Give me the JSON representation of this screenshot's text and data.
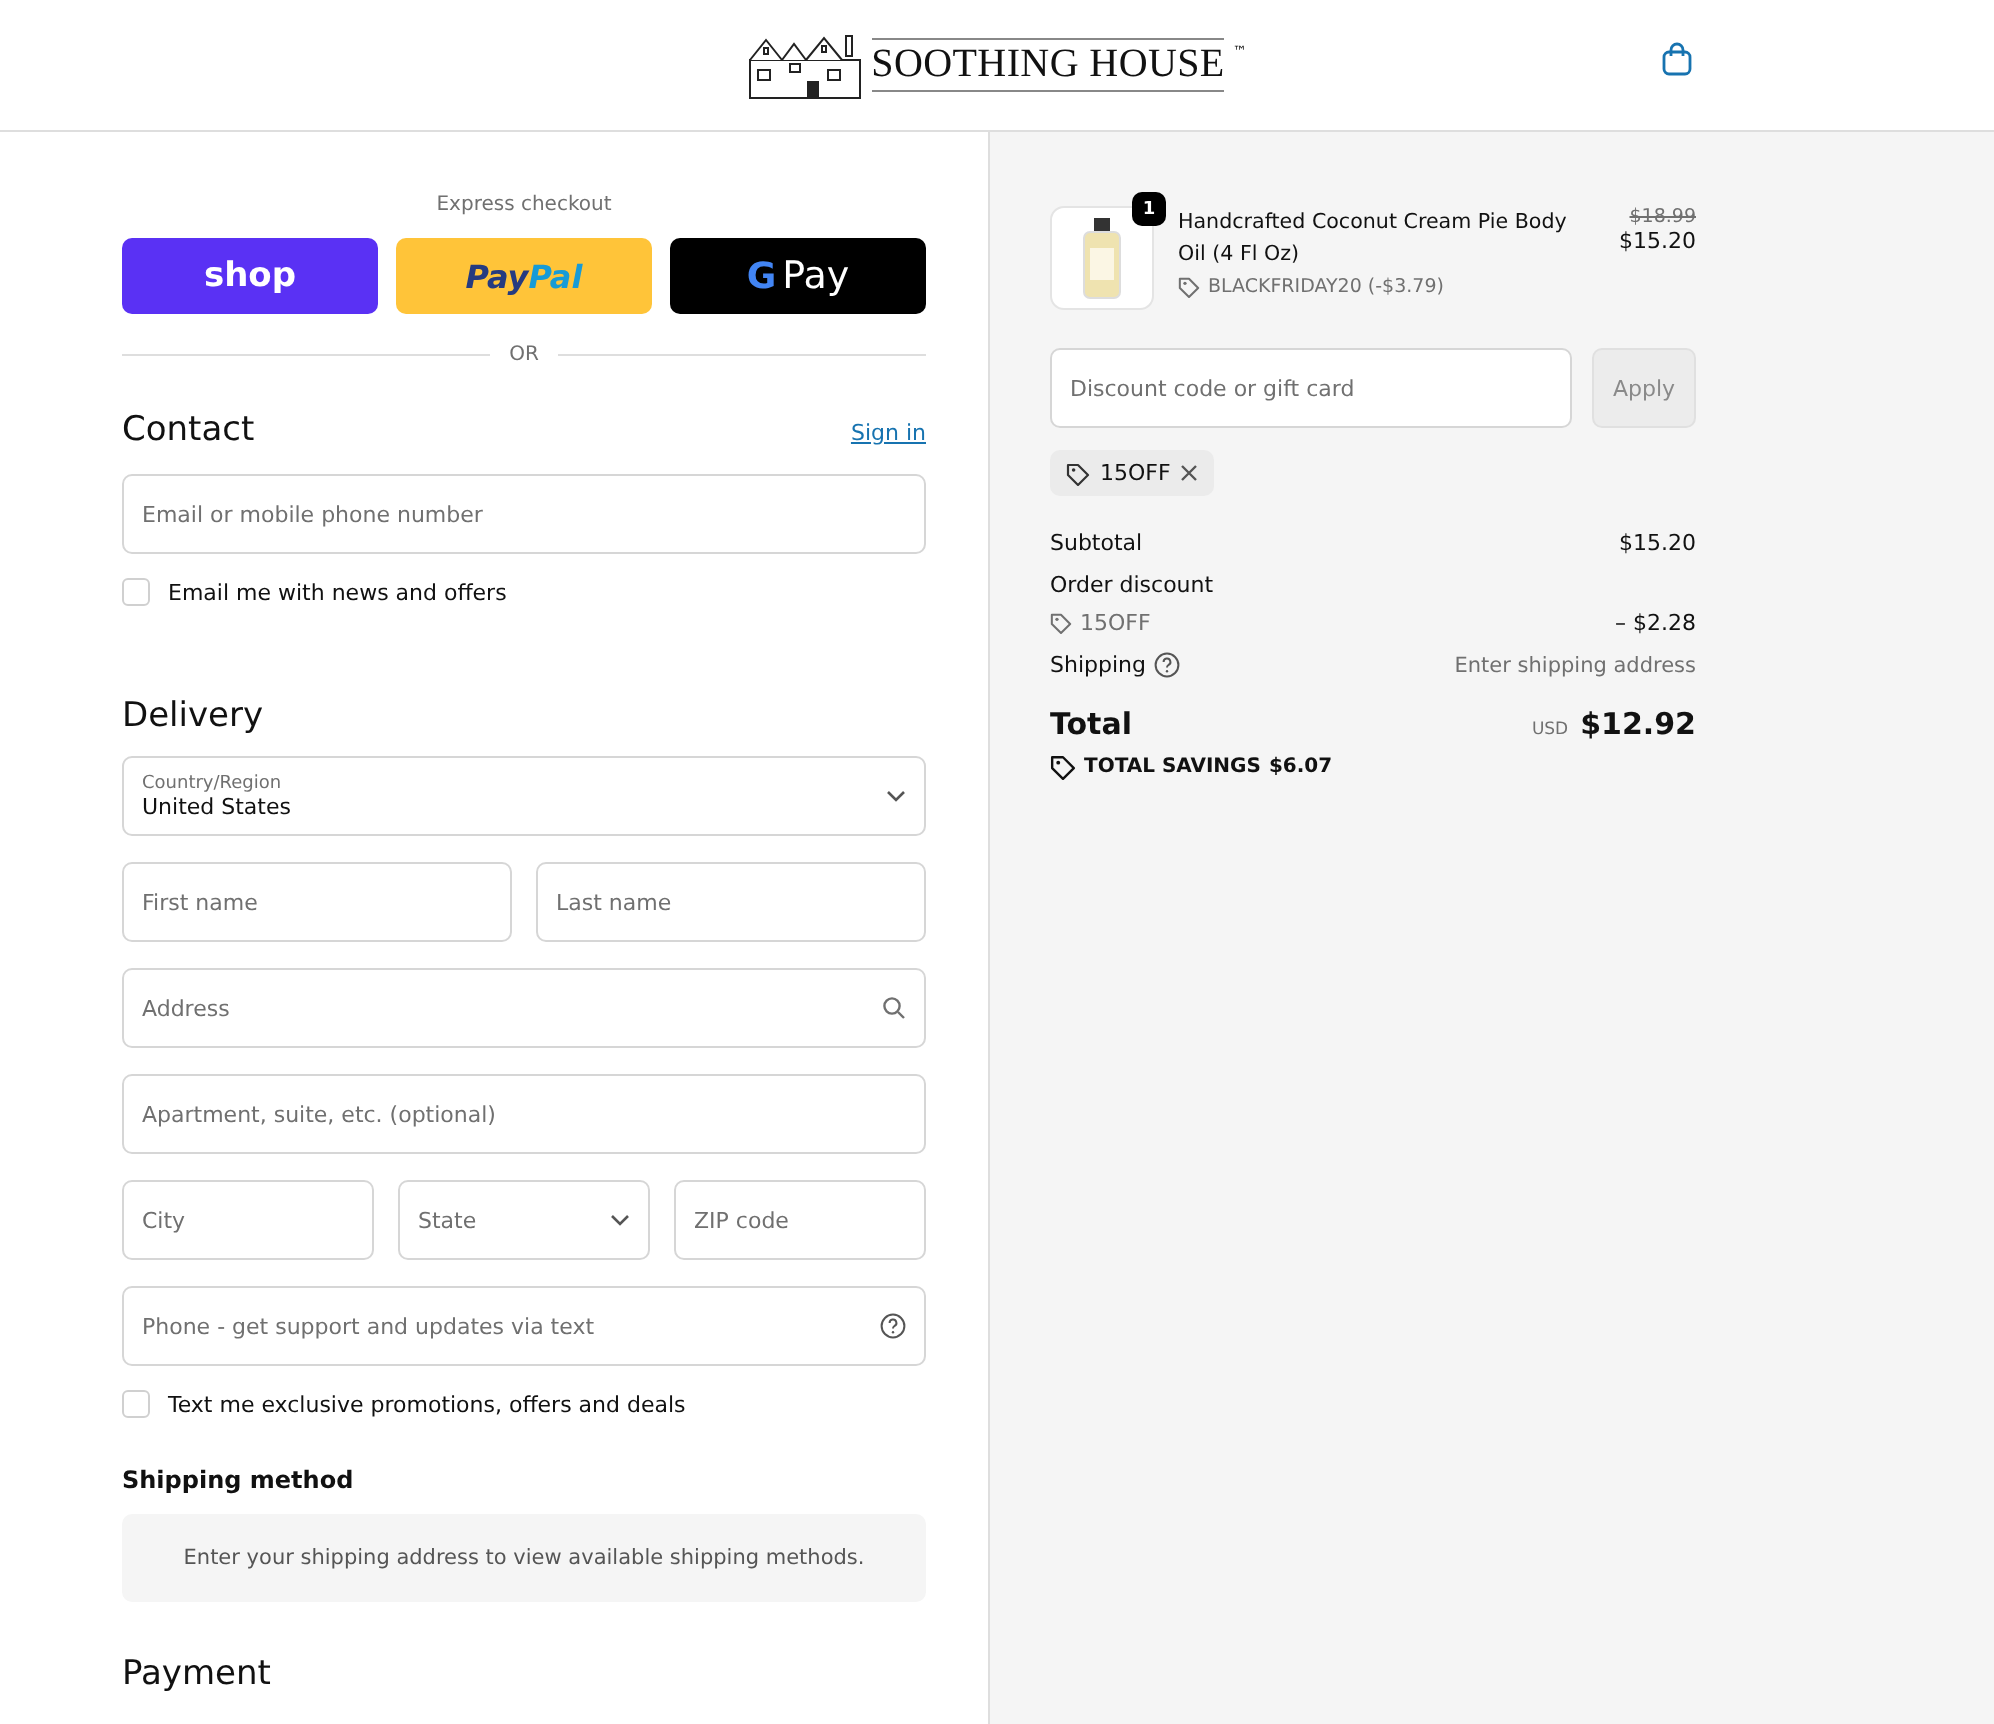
{
  "header": {
    "brand": "SOOTHING HOUSE",
    "trademark": "™"
  },
  "express": {
    "title": "Express checkout",
    "buttons": [
      {
        "kind": "shop",
        "label": "shop"
      },
      {
        "kind": "paypal",
        "label": "Pay",
        "label2": "Pal"
      },
      {
        "kind": "gpay",
        "label": "G",
        "label2": "Pay"
      }
    ],
    "divider": "OR"
  },
  "contact": {
    "title": "Contact",
    "link": "Sign in",
    "field": {
      "placeholder": "Email or mobile phone number"
    },
    "checkbox": {
      "label": "Email me with news and offers",
      "checked": false
    }
  },
  "delivery": {
    "title": "Delivery",
    "rows": [
      [
        {
          "kind": "select",
          "label": "Country/Region",
          "value": "United States"
        }
      ],
      [
        {
          "kind": "text",
          "placeholder": "First name"
        },
        {
          "kind": "text",
          "placeholder": "Last name"
        }
      ],
      [
        {
          "kind": "search",
          "placeholder": "Address"
        }
      ],
      [
        {
          "kind": "text",
          "placeholder": "Apartment, suite, etc. (optional)"
        }
      ],
      [
        {
          "kind": "text",
          "placeholder": "City"
        },
        {
          "kind": "select",
          "placeholder": "State"
        },
        {
          "kind": "text",
          "placeholder": "ZIP code"
        }
      ],
      [
        {
          "kind": "help",
          "placeholder": "Phone - get support and updates via text"
        }
      ]
    ],
    "checkbox": {
      "label": "Text me exclusive promotions, offers and deals",
      "checked": false
    }
  },
  "shipping_method": {
    "title": "Shipping method",
    "message": "Enter your shipping address to view available shipping methods."
  },
  "payment": {
    "title": "Payment"
  },
  "summary": {
    "item": {
      "name": "Handcrafted Coconut Cream Pie Body Oil (4 Fl Oz)",
      "quantity": "1",
      "discount": "BLACKFRIDAY20 (-$3.79)",
      "original_price": "$18.99",
      "price": "$15.20"
    },
    "discount_field": {
      "placeholder": "Discount code or gift card"
    },
    "apply": "Apply",
    "applied_code": "15OFF",
    "subtotal": {
      "label": "Subtotal",
      "value": "$15.20"
    },
    "order_discount": {
      "label": "Order discount",
      "code": "15OFF",
      "value": "– $2.28"
    },
    "shipping": {
      "label": "Shipping",
      "value": "Enter shipping address"
    },
    "total": {
      "label": "Total",
      "currency": "USD",
      "value": "$12.92"
    },
    "savings": {
      "label": "TOTAL SAVINGS",
      "value": "$6.07"
    }
  }
}
